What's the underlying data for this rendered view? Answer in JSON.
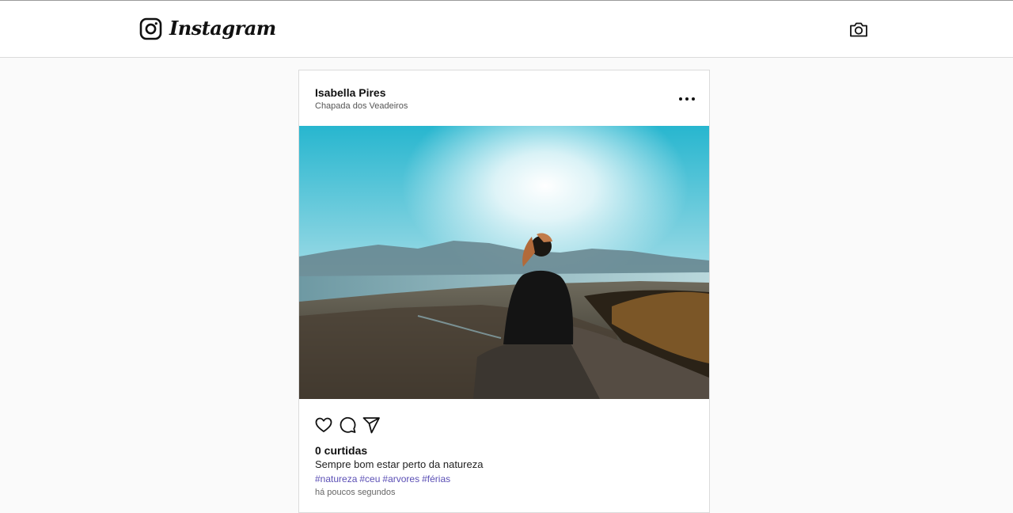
{
  "header": {
    "brand": "Instagram",
    "logo_icon": "instagram-logo-icon",
    "camera_icon": "camera-icon"
  },
  "post": {
    "username": "Isabella Pires",
    "location": "Chapada dos Veadeiros",
    "more_icon": "more-options-icon",
    "image_alt": "photo-woman-on-mountain",
    "actions": [
      "heart-icon",
      "comment-icon",
      "share-icon"
    ],
    "likes": "0 curtidas",
    "caption": "Sempre bom estar perto da natureza",
    "tags": [
      "#natureza",
      "#ceu",
      "#arvores",
      "#férias"
    ],
    "time": "há poucos segundos",
    "tag_color": "#5b4fb5"
  }
}
